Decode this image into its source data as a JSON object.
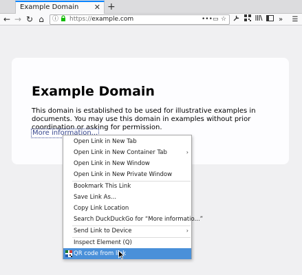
{
  "tab": {
    "title": "Example Domain",
    "close": "✕"
  },
  "new_tab": "+",
  "nav": {
    "back": "←",
    "forward": "→",
    "reload": "↻",
    "home": "⌂"
  },
  "urlbar": {
    "info_icon": "ⓘ",
    "lock_icon": "🔒",
    "scheme": "https://",
    "host": "example.com",
    "more": "•••",
    "reader": "▭",
    "star": "☆"
  },
  "toolbar": {
    "wrench": "🔧",
    "qr": "▦",
    "library": "|||\\",
    "sidebar": "▯",
    "screenshot": "⬚",
    "overflow": "»",
    "menu": "☰"
  },
  "page": {
    "title": "Example Domain",
    "text": "This domain is established to be used for illustrative examples in documents. You may use this domain in examples without prior coordination or asking for permission.",
    "link": "More information..."
  },
  "menu": {
    "items": [
      {
        "label": "Open Link in New Tab",
        "submenu": false
      },
      {
        "label": "Open Link in New Container Tab",
        "submenu": true
      },
      {
        "label": "Open Link in New Window",
        "submenu": false
      },
      {
        "label": "Open Link in New Private Window",
        "submenu": false
      },
      {
        "label": "Bookmark This Link",
        "submenu": false
      },
      {
        "label": "Save Link As...",
        "submenu": false
      },
      {
        "label": "Copy Link Location",
        "submenu": false
      },
      {
        "label": "Search DuckDuckGo for “More informatio...”",
        "submenu": false
      },
      {
        "label": "Send Link to Device",
        "submenu": true
      },
      {
        "label": "Inspect Element (Q)",
        "submenu": false
      },
      {
        "label": "QR code from link",
        "submenu": false,
        "highlighted": true
      }
    ],
    "submenu_arrow": "›",
    "highlight_color": "#4a90d9"
  }
}
